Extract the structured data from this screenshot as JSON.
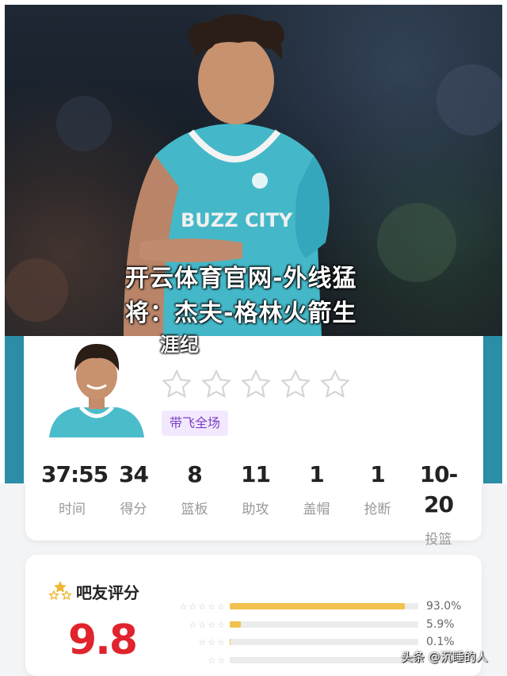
{
  "headline": {
    "line1": "开云体育官网-外线猛",
    "line2": "将：杰夫-格林火箭生",
    "line3": "涯纪"
  },
  "photo": {
    "jersey_text": "BUZZ CITY"
  },
  "player_card": {
    "rating_stars": 0,
    "rating_max": 5,
    "badge": "带飞全场",
    "stats": [
      {
        "value": "37:55",
        "label": "时间"
      },
      {
        "value": "34",
        "label": "得分"
      },
      {
        "value": "8",
        "label": "篮板"
      },
      {
        "value": "11",
        "label": "助攻"
      },
      {
        "value": "1",
        "label": "盖帽"
      },
      {
        "value": "1",
        "label": "抢断"
      },
      {
        "value": "10-20",
        "label": "投篮"
      }
    ]
  },
  "fan_rating": {
    "title": "吧友评分",
    "score": "9.8",
    "distribution": [
      {
        "stars": 5,
        "percent": 93.0,
        "label": "93.0%"
      },
      {
        "stars": 4,
        "percent": 5.9,
        "label": "5.9%"
      },
      {
        "stars": 3,
        "percent": 0.1,
        "label": "0.1%"
      },
      {
        "stars": 2,
        "percent": 0.0,
        "label": ""
      }
    ]
  },
  "watermark": "头条 @沉睡的人",
  "colors": {
    "accent_teal": "#2b8ea6",
    "score_red": "#e0232d",
    "badge_purple": "#7b3fc4",
    "bar_gold": "#f2c14e"
  }
}
